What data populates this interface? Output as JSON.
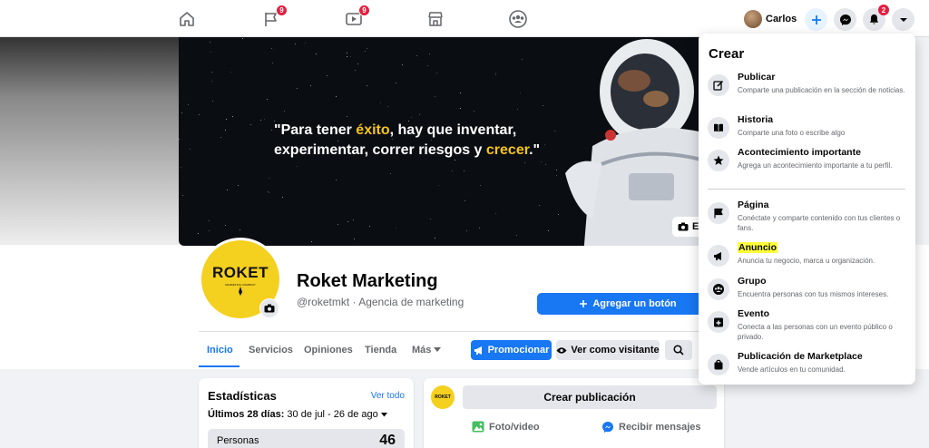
{
  "topbar": {
    "nav": [
      {
        "name": "home-icon"
      },
      {
        "name": "flag-icon",
        "badge": "9"
      },
      {
        "name": "watch-icon",
        "badge": "9"
      },
      {
        "name": "marketplace-icon"
      },
      {
        "name": "groups-icon"
      }
    ],
    "profile_name": "Carlos",
    "notifications_badge": "2"
  },
  "cover": {
    "quote_part1": "\"Para tener ",
    "quote_hl1": "éxito",
    "quote_part2": ", hay que inventar, experimentar, correr riesgos y ",
    "quote_hl2": "crecer",
    "quote_part3": ".\"",
    "edit_label": "E"
  },
  "page": {
    "name": "Roket Marketing",
    "handle": "@roketmkt · Agencia de marketing",
    "logo_text": "ROKET",
    "logo_sub": "MARKETING COMPANY",
    "add_button": "Agregar un botón"
  },
  "tabs": [
    "Inicio",
    "Servicios",
    "Opiniones",
    "Tienda",
    "Más"
  ],
  "actions": {
    "promote": "Promocionar",
    "view_as_visitor": "Ver como visitante"
  },
  "stats": {
    "title": "Estadísticas",
    "see_all": "Ver todo",
    "range_label": "Últimos 28 días:",
    "range_value": " 30 de jul - 26 de ago",
    "row_label": "Personas",
    "row_value": "46"
  },
  "composer": {
    "avatar_text": "ROKET",
    "create_post": "Crear publicación",
    "photo_video": "Foto/video",
    "get_messages": "Recibir mensajes"
  },
  "create_menu": {
    "title": "Crear",
    "items": [
      {
        "label": "Publicar",
        "desc": "Comparte una publicación en la sección de noticias.",
        "icon": "compose-icon"
      },
      {
        "label": "Historia",
        "desc": "Comparte una foto o escribe algo",
        "icon": "book-icon"
      },
      {
        "label": "Acontecimiento importante",
        "desc": "Agrega un acontecimiento importante a tu perfil.",
        "icon": "star-icon"
      },
      {
        "label": "Página",
        "desc": "Conéctate y comparte contenido con tus clientes o fans.",
        "icon": "flag-icon"
      },
      {
        "label": "Anuncio",
        "desc": "Anuncia tu negocio, marca u organización.",
        "icon": "megaphone-icon"
      },
      {
        "label": "Grupo",
        "desc": "Encuentra personas con tus mismos intereses.",
        "icon": "group-icon"
      },
      {
        "label": "Evento",
        "desc": "Conecta a las personas con un evento público o privado.",
        "icon": "calendar-plus-icon"
      },
      {
        "label": "Publicación de Marketplace",
        "desc": "Vende artículos en tu comunidad.",
        "icon": "bag-icon"
      }
    ]
  },
  "colors": {
    "brand_blue": "#1877f2",
    "logo_yellow": "#f4d01f",
    "highlight": "#ffff3a",
    "badge_red": "#e41e3f"
  }
}
